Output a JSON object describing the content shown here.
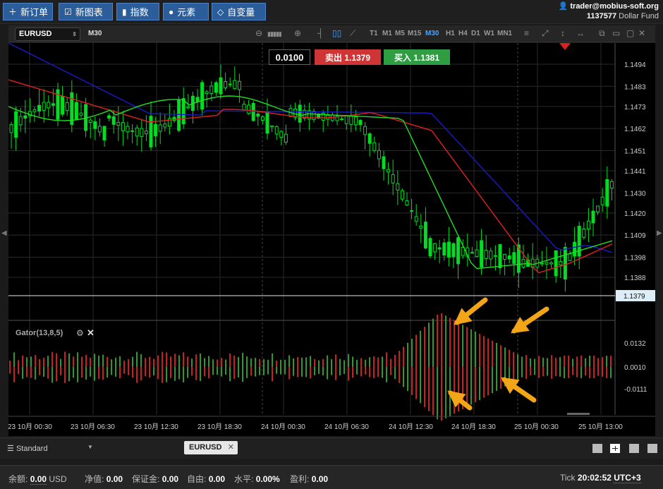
{
  "toolbar": {
    "new_order": "新订单",
    "new_chart": "新图表",
    "indicators": "指数",
    "elements": "元素",
    "custom_vars": "自变量"
  },
  "account": {
    "user": "trader@mobius-soft.org",
    "number": "1137577",
    "name": "Dollar Fund"
  },
  "chart": {
    "symbol": "EURUSD",
    "timeframe": "M30",
    "timeframes": [
      "T1",
      "M1",
      "M5",
      "M15",
      "M30",
      "H1",
      "H4",
      "D1",
      "W1",
      "MN1"
    ],
    "active_timeframe": "M30",
    "lot": "0.0100",
    "sell_label": "卖出 1.1379",
    "buy_label": "买入 1.1381",
    "current_price": "1.1379",
    "price_ticks": [
      "1.1494",
      "1.1483",
      "1.1473",
      "1.1462",
      "1.1451",
      "1.1441",
      "1.1430",
      "1.1420",
      "1.1409",
      "1.1398",
      "1.1388"
    ],
    "time_ticks": [
      "23 10月 00:30",
      "23 10月 06:30",
      "23 10月 12:30",
      "23 10月 18:30",
      "24 10月 00:30",
      "24 10月 06:30",
      "24 10月 12:30",
      "24 10月 18:30",
      "25 10月 00:30",
      "25 10月 13:00"
    ],
    "gator_label": "Gator(13,8,5)",
    "gator_ticks": [
      "0.0132",
      "0.0010",
      "-0.0111"
    ],
    "colors": {
      "up": "#00dd22",
      "down": "#00dd22",
      "lips": "#22dd22",
      "teeth": "#e02020",
      "jaw": "#1a1acc",
      "gator_up": "#2e9a2e",
      "gator_down": "#cc2020",
      "arrow": "#f2a516"
    }
  },
  "tabs": {
    "workspace": "Standard",
    "symbol_tab": "EURUSD"
  },
  "status": {
    "balance_label": "余额:",
    "balance_value": "0.00",
    "currency": "USD",
    "equity_label": "净值:",
    "equity_value": "0.00",
    "margin_label": "保证金:",
    "margin_value": "0.00",
    "free_label": "自由:",
    "free_value": "0.00",
    "level_label": "水平:",
    "level_value": "0.00%",
    "profit_label": "盈利:",
    "profit_value": "0.00",
    "tick_label": "Tick",
    "time": "20:02:52",
    "tz": "UTC+3"
  }
}
